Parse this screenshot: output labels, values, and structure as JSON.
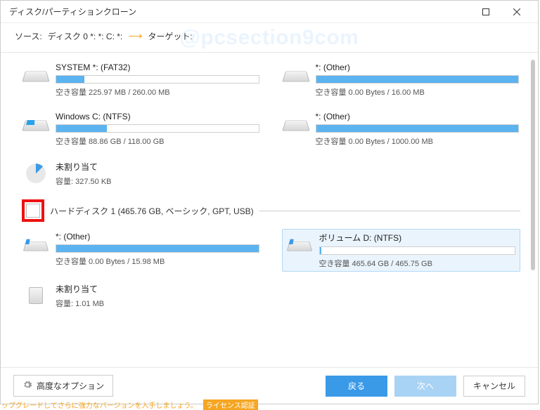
{
  "title": "ディスク/パーティションクローン",
  "pathbar": {
    "source_label": "ソース:",
    "source_value": "ディスク 0 *: *: C: *:",
    "target_label": "ターゲット:"
  },
  "watermark": "@pcsection9com",
  "partitions_top": [
    {
      "name": "SYSTEM *: (FAT32)",
      "info": "空き容量 225.97 MB / 260.00 MB",
      "fill": 14
    },
    {
      "name": "*: (Other)",
      "info": "空き容量 0.00 Bytes / 16.00 MB",
      "fill": 100
    },
    {
      "name": "Windows C: (NTFS)",
      "info": "空き容量 88.86 GB / 118.00 GB",
      "fill": 25,
      "win": true
    },
    {
      "name": "*: (Other)",
      "info": "空き容量 0.00 Bytes / 1000.00 MB",
      "fill": 100
    },
    {
      "name": "未割り当て",
      "info": "容量: 327.50 KB",
      "pie": true,
      "nobar": true
    }
  ],
  "disk1_label": "ハードディスク 1 (465.76 GB, ベーシック, GPT, USB)",
  "partitions_disk1": [
    {
      "name": "*: (Other)",
      "info": "空き容量 0.00 Bytes / 15.98 MB",
      "fill": 100,
      "usb": true
    },
    {
      "name": "ボリューム D: (NTFS)",
      "info": "空き容量 465.64 GB / 465.75 GB",
      "fill": 1,
      "usb": true,
      "selected": true
    },
    {
      "name": "未割り当て",
      "info": "容量: 1.01 MB",
      "stub": true,
      "nobar": true
    }
  ],
  "footer": {
    "advanced": "高度なオプション",
    "back": "戻る",
    "next": "次へ",
    "cancel": "キャンセル"
  },
  "bottom": {
    "text": "ップグレードしてさらに強力なバージョンを入手しましょう。",
    "tag": "ライセンス認証"
  }
}
